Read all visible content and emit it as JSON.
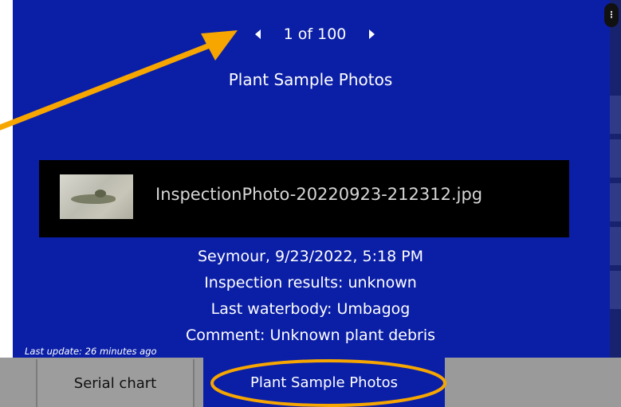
{
  "pager": {
    "text": "1 of 100",
    "current": 1,
    "total": 100
  },
  "title": "Plant Sample Photos",
  "attachment": {
    "filename": "InspectionPhoto-20220923-212312.jpg"
  },
  "details": [
    "Seymour,  9/23/2022, 5:18 PM",
    "Inspection results: unknown",
    "Last waterbody: Umbagog",
    "Comment: Unknown plant debris"
  ],
  "last_update": "Last update: 26 minutes ago",
  "tabs": [
    {
      "label": "Serial chart",
      "active": false
    },
    {
      "label": "Plant Sample Photos",
      "active": true
    }
  ],
  "colors": {
    "panel": "#0b1fa6",
    "annotation": "#f7a600",
    "tabbar": "#9a9a9a"
  }
}
